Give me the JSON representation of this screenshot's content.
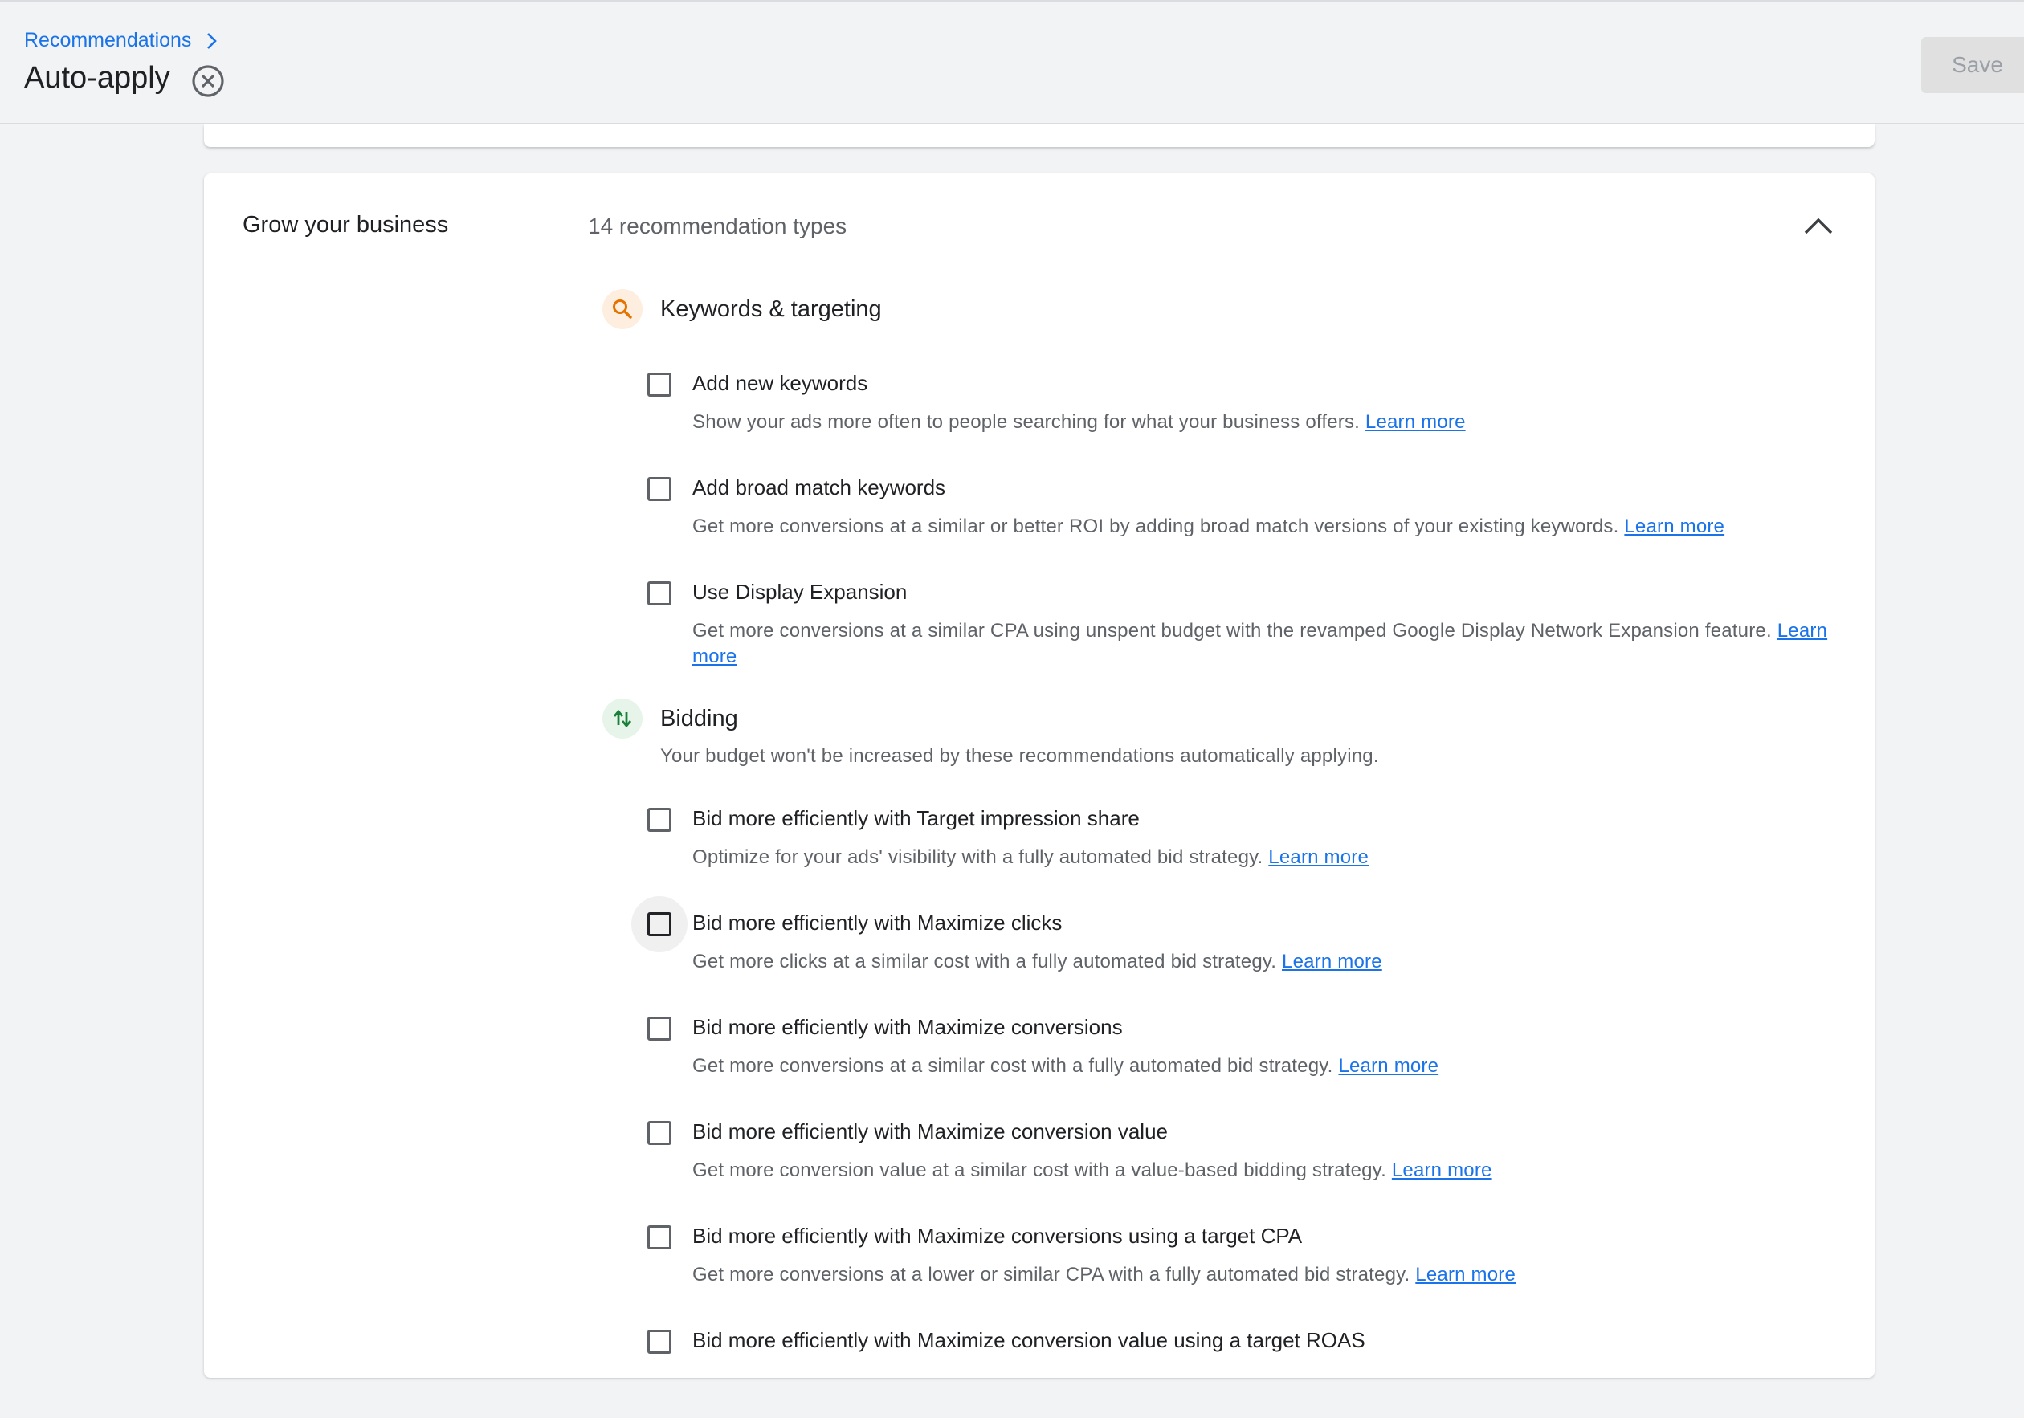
{
  "header": {
    "breadcrumb": "Recommendations",
    "title": "Auto-apply",
    "save_label": "Save"
  },
  "card": {
    "title": "Grow your business",
    "count_label": "14 recommendation types",
    "sections": {
      "keywords": {
        "title": "Keywords & targeting",
        "icon": "search-icon",
        "icon_color": "#e37400",
        "items": [
          {
            "label": "Add new keywords",
            "desc": "Show your ads more often to people searching for what your business offers.",
            "link": "Learn more"
          },
          {
            "label": "Add broad match keywords",
            "desc": "Get more conversions at a similar or better ROI by adding broad match versions of your existing keywords.",
            "link": "Learn more"
          },
          {
            "label": "Use Display Expansion",
            "desc": "Get more conversions at a similar CPA using unspent budget with the revamped Google Display Network Expansion feature.",
            "link": "Learn more"
          }
        ]
      },
      "bidding": {
        "title": "Bidding",
        "icon": "swap-vertical-icon",
        "icon_color": "#188038",
        "note": "Your budget won't be increased by these recommendations automatically applying.",
        "items": [
          {
            "label": "Bid more efficiently with Target impression share",
            "desc": "Optimize for your ads' visibility with a fully automated bid strategy.",
            "link": "Learn more"
          },
          {
            "label": "Bid more efficiently with Maximize clicks",
            "desc": "Get more clicks at a similar cost with a fully automated bid strategy.",
            "link": "Learn more"
          },
          {
            "label": "Bid more efficiently with Maximize conversions",
            "desc": "Get more conversions at a similar cost with a fully automated bid strategy.",
            "link": "Learn more"
          },
          {
            "label": "Bid more efficiently with Maximize conversion value",
            "desc": "Get more conversion value at a similar cost with a value-based bidding strategy.",
            "link": "Learn more"
          },
          {
            "label": "Bid more efficiently with Maximize conversions using a target CPA",
            "desc": "Get more conversions at a lower or similar CPA with a fully automated bid strategy.",
            "link": "Learn more"
          },
          {
            "label": "Bid more efficiently with Maximize conversion value using a target ROAS",
            "desc": "",
            "link": ""
          }
        ]
      }
    }
  }
}
